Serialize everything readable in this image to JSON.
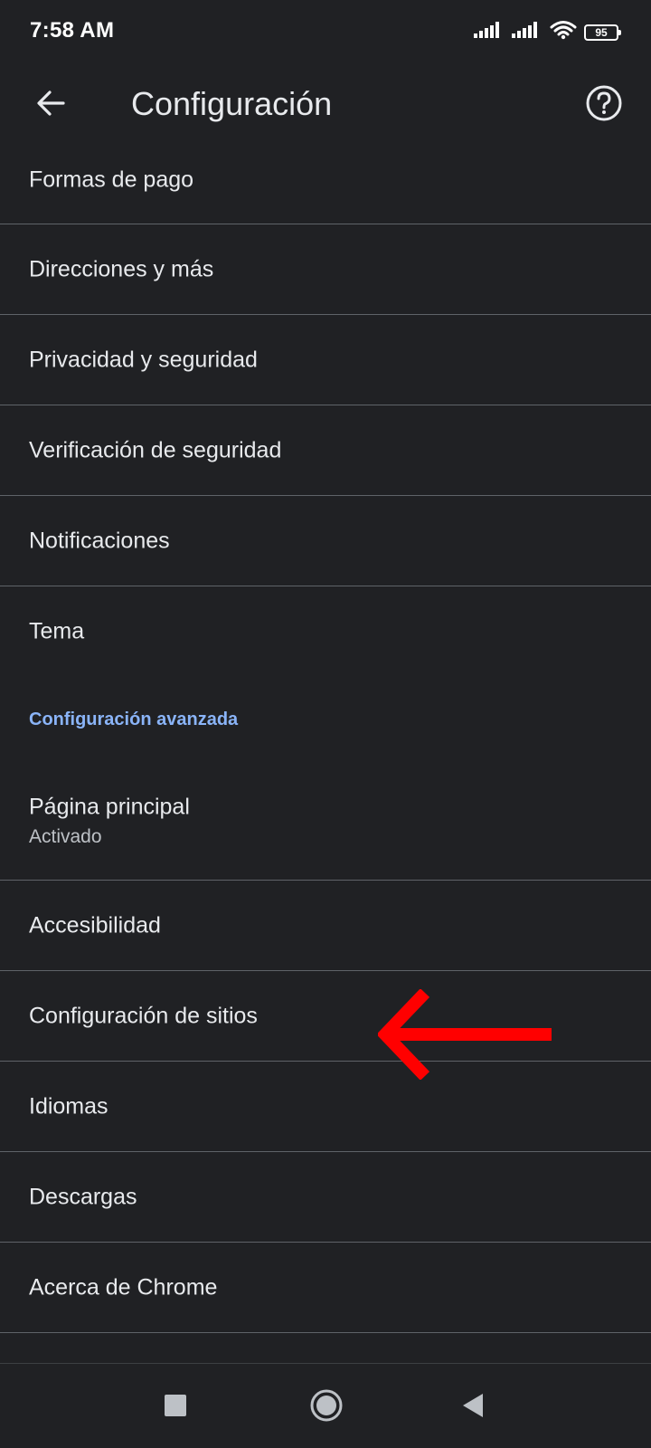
{
  "status_bar": {
    "time": "7:58 AM",
    "battery_level": "95",
    "icons": [
      "signal-icon",
      "signal-icon",
      "wifi-icon",
      "battery-icon"
    ]
  },
  "app_bar": {
    "title": "Configuración",
    "back_icon": "back-arrow-icon",
    "help_icon": "help-icon"
  },
  "settings": {
    "items": [
      {
        "label": "Formas de pago"
      },
      {
        "label": "Direcciones y más"
      },
      {
        "label": "Privacidad y seguridad"
      },
      {
        "label": "Verificación de seguridad"
      },
      {
        "label": "Notificaciones"
      },
      {
        "label": "Tema"
      }
    ],
    "advanced_header": "Configuración avanzada",
    "advanced_items": [
      {
        "label": "Página principal",
        "sublabel": "Activado"
      },
      {
        "label": "Accesibilidad"
      },
      {
        "label": "Configuración de sitios"
      },
      {
        "label": "Idiomas"
      },
      {
        "label": "Descargas"
      },
      {
        "label": "Acerca de Chrome"
      }
    ]
  },
  "annotation": {
    "arrow_color": "#ff0000",
    "points_to": "Configuración de sitios"
  },
  "colors": {
    "background": "#202124",
    "text_primary": "#e8eaed",
    "text_secondary": "#bdc1c6",
    "accent": "#8ab4f8",
    "divider": "#5f6368"
  },
  "nav_bar": {
    "icons": [
      "recents-icon",
      "home-icon",
      "back-icon"
    ]
  }
}
